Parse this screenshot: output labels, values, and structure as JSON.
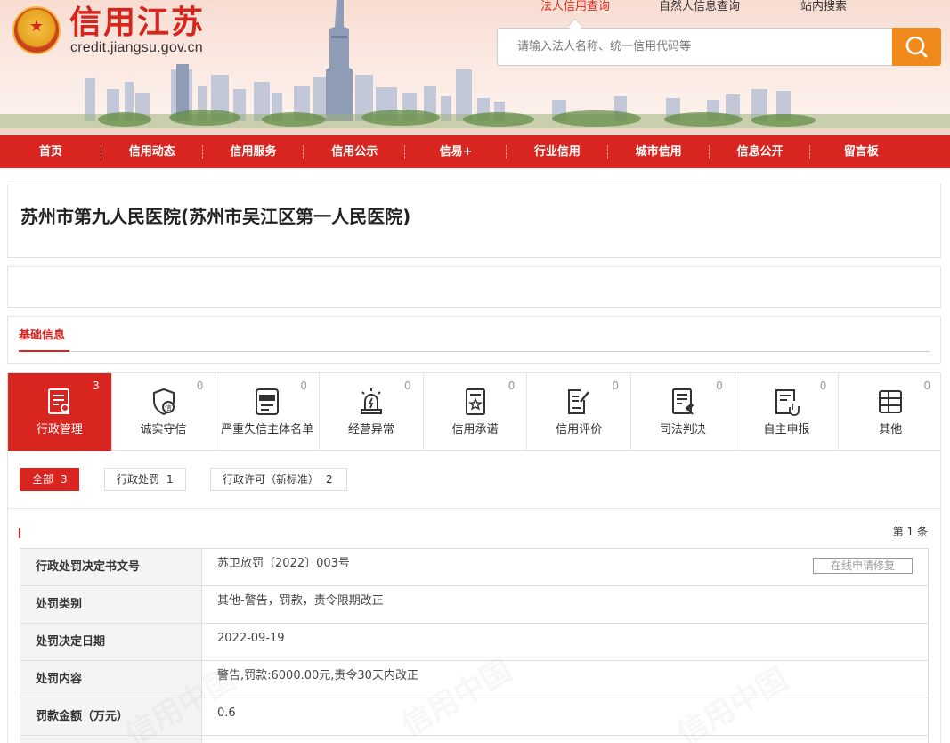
{
  "site": {
    "title": "信用江苏",
    "domain": "credit.jiangsu.gov.cn"
  },
  "search": {
    "tabs": [
      "法人信用查询",
      "自然人信息查询",
      "站内搜索"
    ],
    "placeholder": "请输入法人名称、统一信用代码等"
  },
  "nav": [
    "首页",
    "信用动态",
    "信用服务",
    "信用公示",
    "信易+",
    "行业信用",
    "城市信用",
    "信息公开",
    "留言板"
  ],
  "entity": {
    "name": "苏州市第九人民医院(苏州市吴江区第一人民医院)"
  },
  "basic_tab": "基础信息",
  "categories": [
    {
      "label": "行政管理",
      "count": "3"
    },
    {
      "label": "诚实守信",
      "count": "0"
    },
    {
      "label": "严重失信主体名单",
      "count": "0"
    },
    {
      "label": "经营异常",
      "count": "0"
    },
    {
      "label": "信用承诺",
      "count": "0"
    },
    {
      "label": "信用评价",
      "count": "0"
    },
    {
      "label": "司法判决",
      "count": "0"
    },
    {
      "label": "自主申报",
      "count": "0"
    },
    {
      "label": "其他",
      "count": "0"
    }
  ],
  "filters": [
    {
      "label": "全部",
      "count": "3"
    },
    {
      "label": "行政处罚",
      "count": "1"
    },
    {
      "label": "行政许可（新标准）",
      "count": "2"
    }
  ],
  "record_count": "第 1 条",
  "record": {
    "fix_button": "在线申请修复",
    "rows": [
      {
        "key": "行政处罚决定书文号",
        "value": "苏卫放罚〔2022〕003号"
      },
      {
        "key": "处罚类别",
        "value": "其他-警告，罚款，责令限期改正"
      },
      {
        "key": "处罚决定日期",
        "value": "2022-09-19"
      },
      {
        "key": "处罚内容",
        "value": "警告,罚款:6000.00元,责令30天内改正"
      },
      {
        "key": "罚款金额（万元）",
        "value": "0.6"
      }
    ]
  },
  "watermark": "信用中国",
  "colors": {
    "brand_red": "#d9251f",
    "search_orange": "#f18a1c"
  }
}
